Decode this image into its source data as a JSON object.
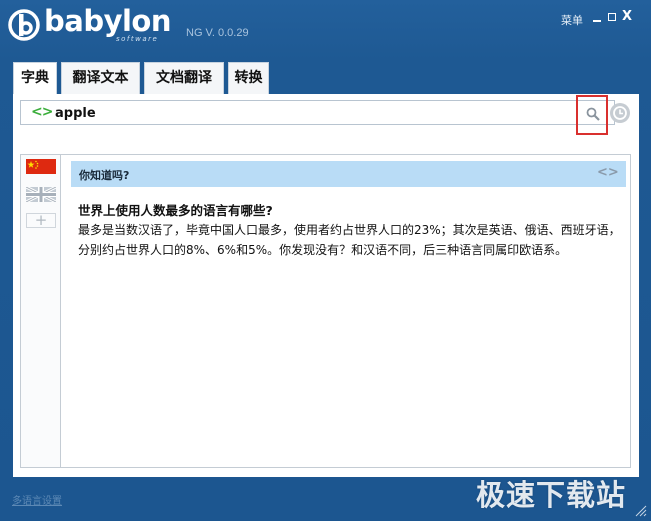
{
  "window": {
    "brand": "babylon",
    "brand_sub": "software",
    "version": "NG V. 0.0.29",
    "menu_label": "菜单",
    "close_glyph": "X"
  },
  "tabs": [
    {
      "label": "字典",
      "active": true
    },
    {
      "label": "翻译文本",
      "active": false
    },
    {
      "label": "文档翻译",
      "active": false
    },
    {
      "label": "转换",
      "active": false
    }
  ],
  "search": {
    "arrows": "<>",
    "value": "apple",
    "icon": "search-icon",
    "history_icon": "history-clock-icon",
    "highlight_color": "#d9302e"
  },
  "languages": [
    {
      "icon": "china-flag-icon"
    },
    {
      "icon": "uk-flag-icon"
    }
  ],
  "add_language_glyph": "+",
  "did_you_know": {
    "title": "你知道吗?",
    "nav_glyph": "<>",
    "question": "世界上使用人数最多的语言有哪些?",
    "answer": "最多是当数汉语了，毕竟中国人口最多，使用者约占世界人口的23%；其次是英语、俄语、西班牙语，分别约占世界人口的8%、6%和5%。你发现没有？和汉语不同，后三种语言同属印欧语系。"
  },
  "footer": {
    "link": "多语言设置"
  },
  "watermark": "极速下载站",
  "colors": {
    "background": "#1f5b94",
    "tab_bg": "#f4f6f8",
    "info_bar": "#b9dcf6",
    "accent_green": "#3cae3c"
  }
}
